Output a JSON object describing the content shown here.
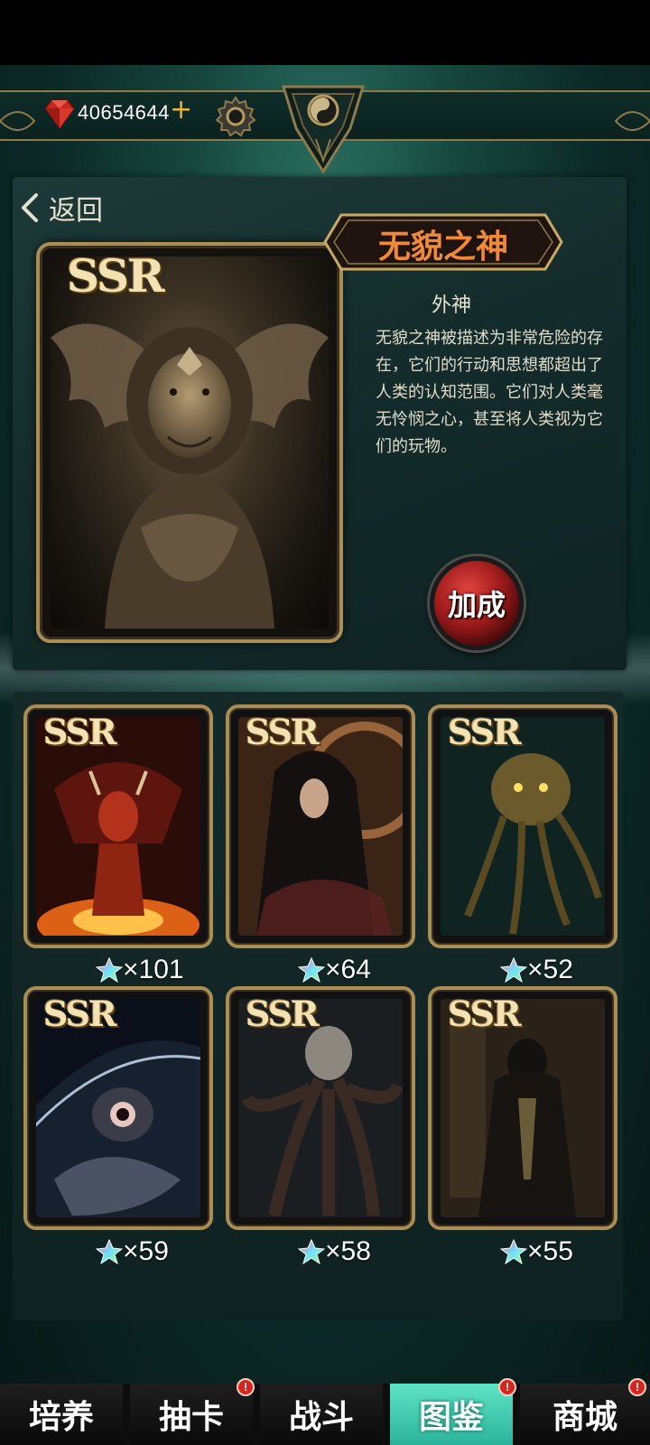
{
  "header": {
    "currency_amount": "40654644",
    "plus_label": "+"
  },
  "detail": {
    "back_label": "返回",
    "rarity": "SSR",
    "name": "无貌之神",
    "type": "外神",
    "description": "无貌之神被描述为非常危险的存在，它们的行动和思想都超出了人类的认知范围。它们对人类毫无怜悯之心，甚至将人类视为它们的玩物。",
    "bonus_button_label": "加成"
  },
  "collection": {
    "cards": [
      {
        "rarity": "SSR",
        "count": "×101",
        "art": "red-demon"
      },
      {
        "rarity": "SSR",
        "count": "×64",
        "art": "veiled-woman"
      },
      {
        "rarity": "SSR",
        "count": "×52",
        "art": "cthulhu"
      },
      {
        "rarity": "SSR",
        "count": "×59",
        "art": "planet-eye"
      },
      {
        "rarity": "SSR",
        "count": "×58",
        "art": "tentacle-horror"
      },
      {
        "rarity": "SSR",
        "count": "×55",
        "art": "robed-figure"
      }
    ]
  },
  "nav": {
    "tabs": [
      {
        "label": "培养",
        "badge": false,
        "active": false
      },
      {
        "label": "抽卡",
        "badge": true,
        "active": false
      },
      {
        "label": "战斗",
        "badge": false,
        "active": false
      },
      {
        "label": "图鉴",
        "badge": true,
        "active": true
      },
      {
        "label": "商城",
        "badge": true,
        "active": false
      }
    ],
    "badge_text": "!"
  },
  "colors": {
    "accent_gold": "#a98d55",
    "name_orange": "#ef8a3a",
    "active_tab": "#3fcfb0",
    "badge_red": "#d9231f"
  }
}
